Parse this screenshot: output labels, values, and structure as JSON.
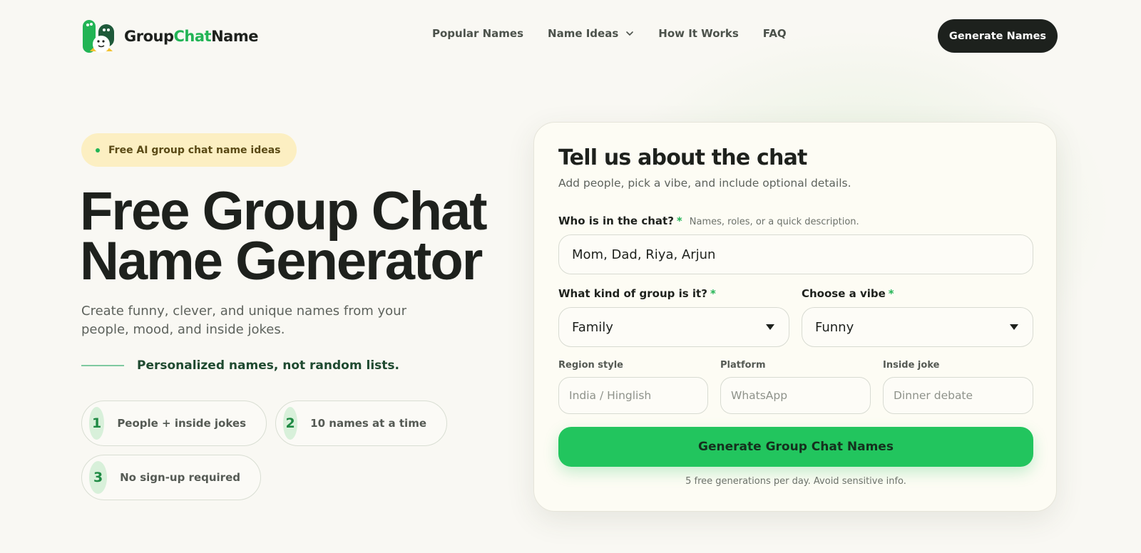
{
  "brand": {
    "name_part1": "Group",
    "name_part2": "Chat",
    "name_part3": "Name",
    "accent": "#22b455"
  },
  "nav": {
    "items": [
      {
        "label": "Popular Names"
      },
      {
        "label": "Name Ideas"
      },
      {
        "label": "How It Works"
      },
      {
        "label": "FAQ"
      }
    ],
    "cta": "Generate Names"
  },
  "hero": {
    "badge": "Free AI group chat name ideas",
    "title_line1": "Free Group Chat",
    "title_line2": "Name Generator",
    "subtitle": "Create funny, clever, and unique names from your people, mood, and inside jokes.",
    "tagline": "Personalized names, not random lists.",
    "features": [
      {
        "num": "1",
        "text": "People + inside jokes"
      },
      {
        "num": "2",
        "text": "10 names at a time"
      },
      {
        "num": "3",
        "text": "No sign-up required"
      }
    ]
  },
  "form": {
    "title": "Tell us about the chat",
    "subtitle": "Add people, pick a vibe, and include optional details.",
    "who": {
      "label": "Who is in the chat?",
      "required": "*",
      "hint": "Names, roles, or a quick description.",
      "value": "Mom, Dad, Riya, Arjun"
    },
    "kind": {
      "label": "What kind of group is it?",
      "required": "*",
      "value": "Family"
    },
    "vibe": {
      "label": "Choose a vibe",
      "required": "*",
      "value": "Funny"
    },
    "region": {
      "label": "Region style",
      "placeholder": "India / Hinglish"
    },
    "platform": {
      "label": "Platform",
      "placeholder": "WhatsApp"
    },
    "joke": {
      "label": "Inside joke",
      "placeholder": "Dinner debate"
    },
    "submit": "Generate Group Chat Names",
    "footnote": "5 free generations per day. Avoid sensitive info."
  }
}
